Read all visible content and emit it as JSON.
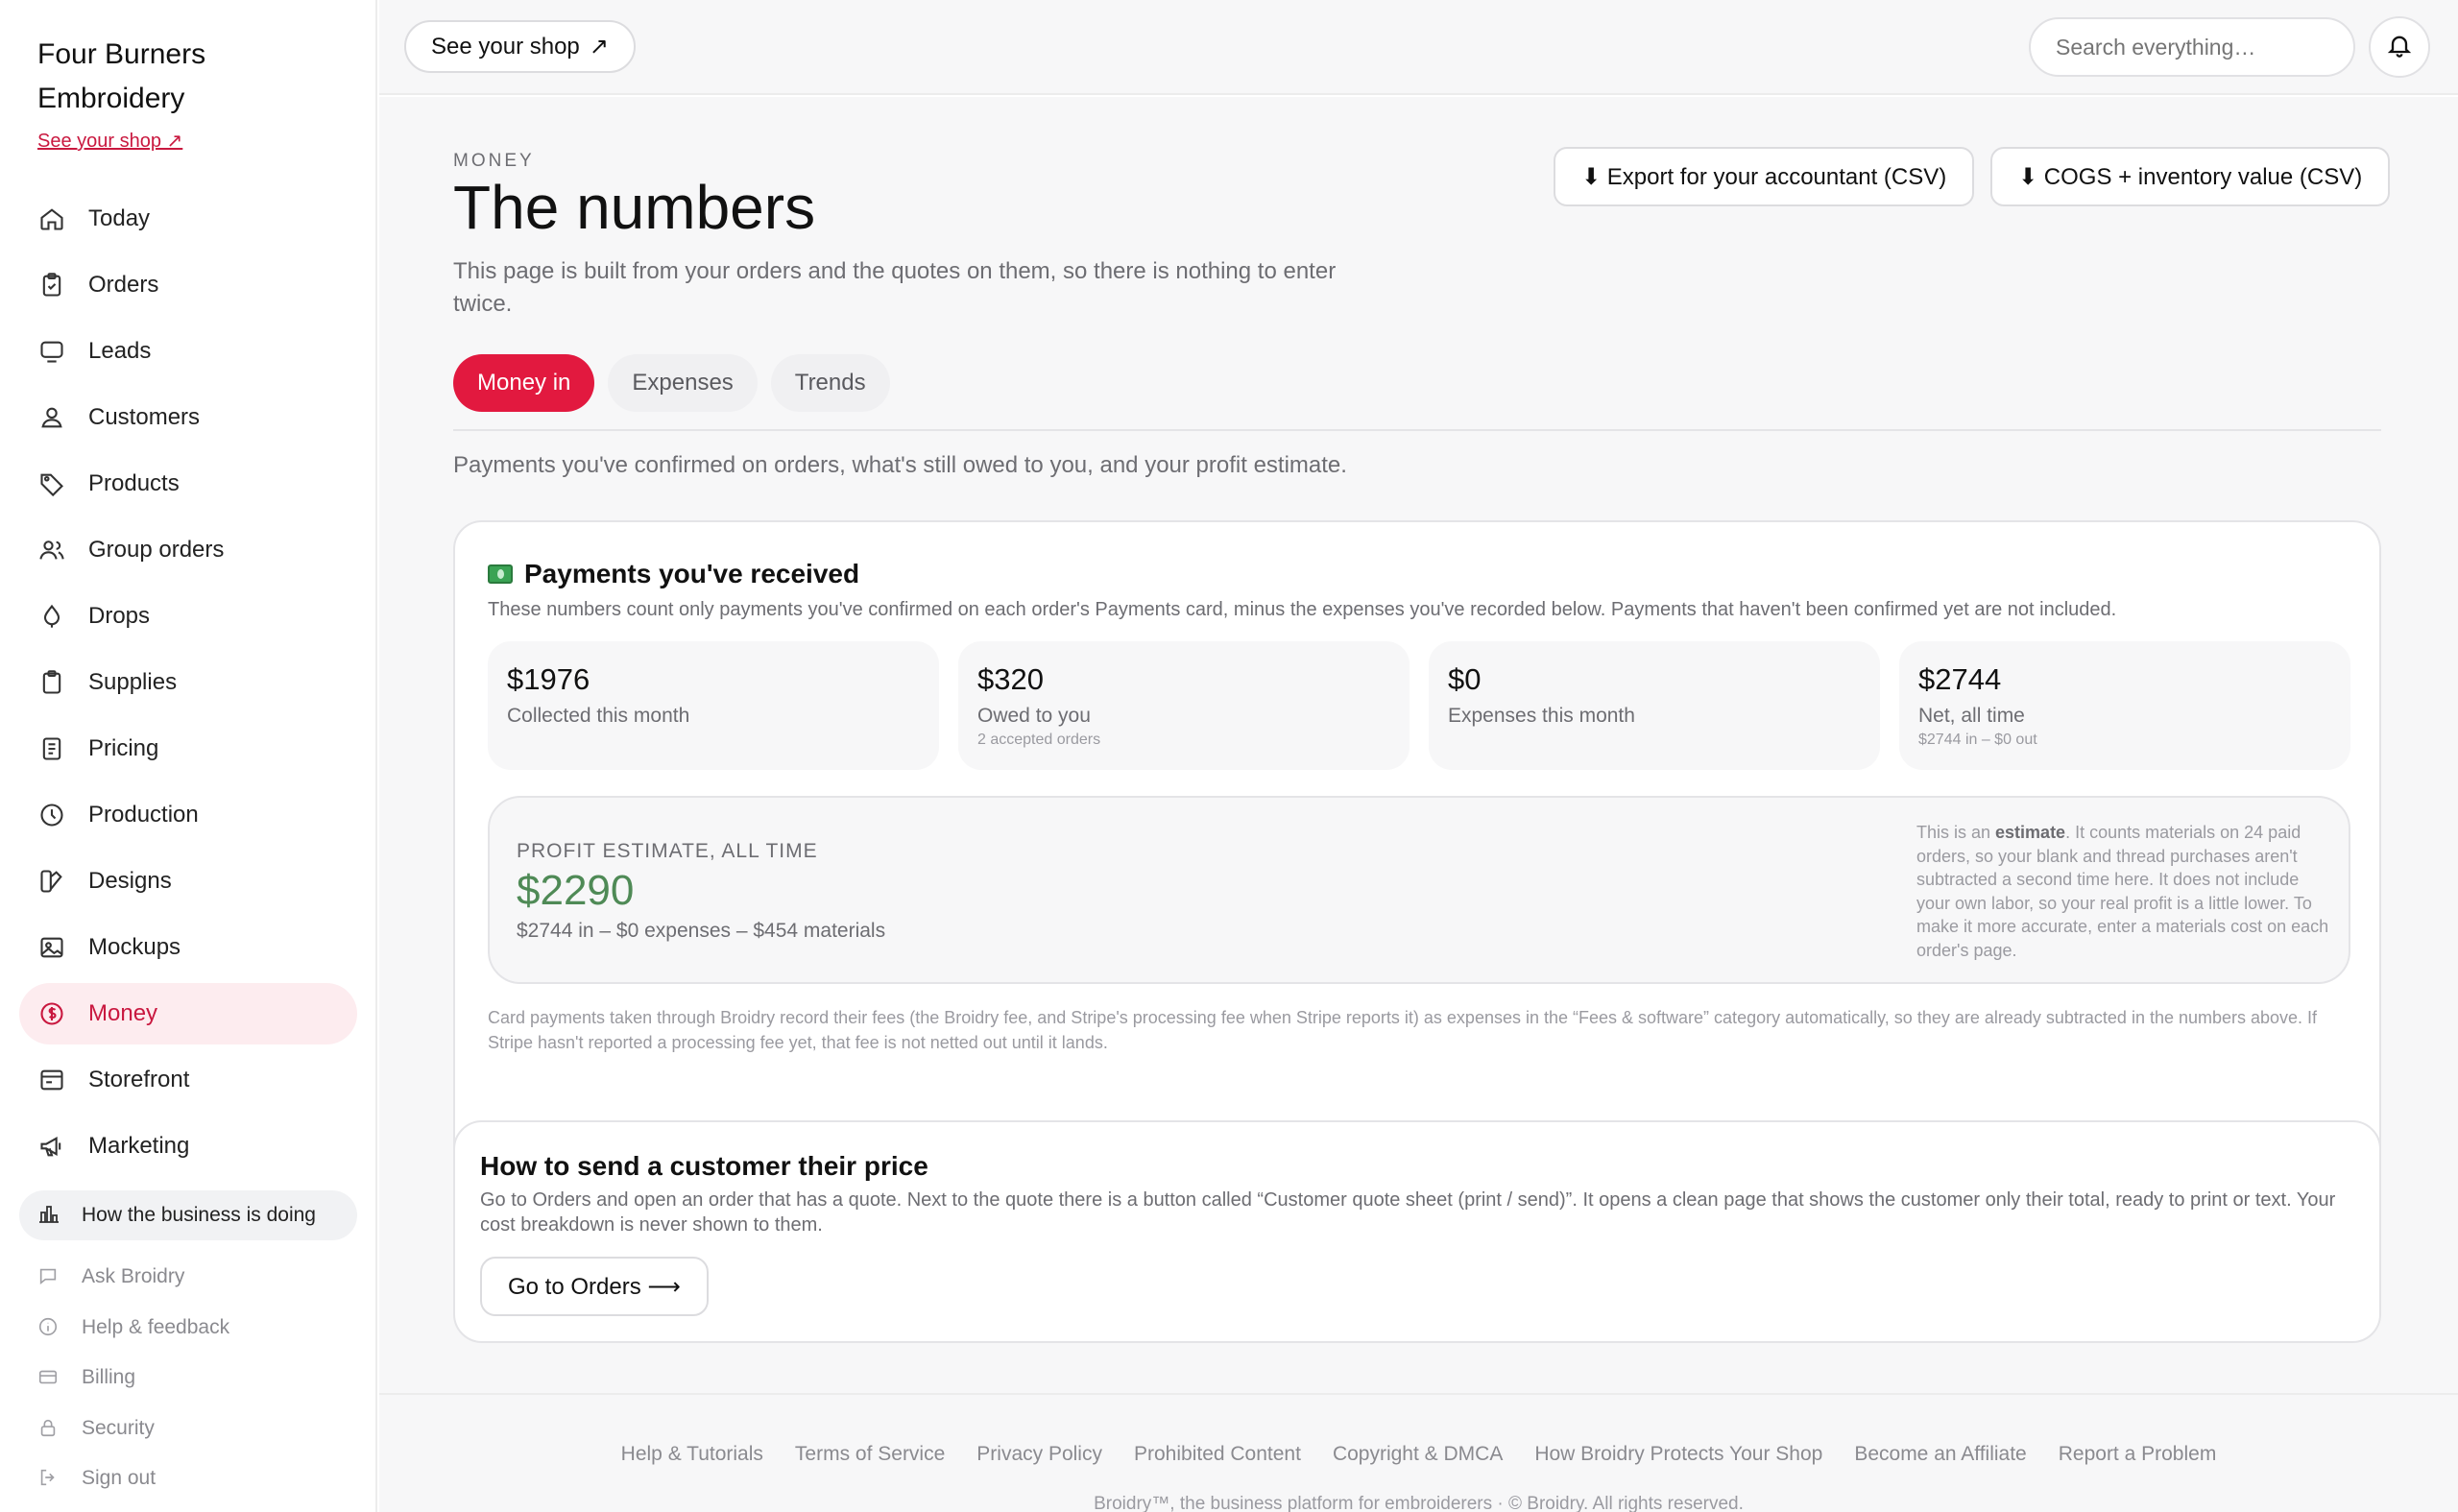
{
  "brand": {
    "name": "Four Burners Embroidery",
    "shop_link": "See your shop ↗"
  },
  "sidebar": {
    "items": [
      {
        "label": "Today",
        "icon": "home-icon"
      },
      {
        "label": "Orders",
        "icon": "clipboard-icon"
      },
      {
        "label": "Leads",
        "icon": "inbox-icon"
      },
      {
        "label": "Customers",
        "icon": "user-icon"
      },
      {
        "label": "Products",
        "icon": "tag-icon"
      },
      {
        "label": "Group orders",
        "icon": "users-icon"
      },
      {
        "label": "Drops",
        "icon": "drop-icon"
      },
      {
        "label": "Supplies",
        "icon": "clipboard-icon"
      },
      {
        "label": "Pricing",
        "icon": "document-icon"
      },
      {
        "label": "Production",
        "icon": "clock-icon"
      },
      {
        "label": "Designs",
        "icon": "palette-icon"
      },
      {
        "label": "Mockups",
        "icon": "image-icon"
      },
      {
        "label": "Money",
        "icon": "dollar-icon",
        "active": true
      },
      {
        "label": "Storefront",
        "icon": "storefront-icon"
      },
      {
        "label": "Marketing",
        "icon": "megaphone-icon"
      }
    ],
    "business_link": "How the business is doing",
    "secondary": [
      {
        "label": "Ask Broidry",
        "icon": "chat-icon"
      },
      {
        "label": "Help & feedback",
        "icon": "info-icon"
      },
      {
        "label": "Billing",
        "icon": "card-icon"
      },
      {
        "label": "Security",
        "icon": "lock-icon"
      },
      {
        "label": "Sign out",
        "icon": "sign-out-icon"
      }
    ]
  },
  "topbar": {
    "shop_button": "See your shop",
    "search_placeholder": "Search everything…"
  },
  "page": {
    "eyebrow": "MONEY",
    "title": "The numbers",
    "lede": "This page is built from your orders and the quotes on them, so there is nothing to enter twice.",
    "export_accountant": "⬇ Export for your accountant (CSV)",
    "export_cogs": "⬇ COGS + inventory value (CSV)",
    "tabs": [
      "Money in",
      "Expenses",
      "Trends"
    ],
    "tab_description": "Payments you've confirmed on orders, what's still owed to you, and your profit estimate."
  },
  "payments": {
    "title": "Payments you've received",
    "description": "These numbers count only payments you've confirmed on each order's Payments card, minus the expenses you've recorded below. Payments that haven't been confirmed yet are not included.",
    "stats": [
      {
        "value": "$1976",
        "label": "Collected this month",
        "sub": ""
      },
      {
        "value": "$320",
        "label": "Owed to you",
        "sub": "2 accepted orders"
      },
      {
        "value": "$0",
        "label": "Expenses this month",
        "sub": ""
      },
      {
        "value": "$2744",
        "label": "Net, all time",
        "sub": "$2744 in – $0 out"
      }
    ],
    "profit": {
      "label": "PROFIT ESTIMATE, ALL TIME",
      "value": "$2290",
      "formula": "$2744 in – $0 expenses – $454 materials",
      "note_pre": "This is an ",
      "note_bold": "estimate",
      "note_post": ". It counts materials on 24 paid orders, so your blank and thread purchases aren't subtracted a second time here. It does not include your own labor, so your real profit is a little lower. To make it more accurate, enter a materials cost on each order's page."
    },
    "footnote": "Card payments taken through Broidry record their fees (the Broidry fee, and Stripe's processing fee when Stripe reports it) as expenses in the “Fees & software” category automatically, so they are already subtracted in the numbers above. If Stripe hasn't reported a processing fee yet, that fee is not netted out until it lands."
  },
  "how": {
    "title": "How to send a customer their price",
    "description": "Go to Orders and open an order that has a quote. Next to the quote there is a button called “Customer quote sheet (print / send)”. It opens a clean page that shows the customer only their total, ready to print or text. Your cost breakdown is never shown to them.",
    "button": "Go to Orders ⟶"
  },
  "footer": {
    "links": [
      "Help & Tutorials",
      "Terms of Service",
      "Privacy Policy",
      "Prohibited Content",
      "Copyright & DMCA",
      "How Broidry Protects Your Shop",
      "Become an Affiliate",
      "Report a Problem"
    ],
    "copyright": "Broidry™, the business platform for embroiderers · © Broidry. All rights reserved."
  },
  "colors": {
    "accent": "#e2193f",
    "active_bg": "#fdecef",
    "profit_green": "#4f8a56"
  }
}
